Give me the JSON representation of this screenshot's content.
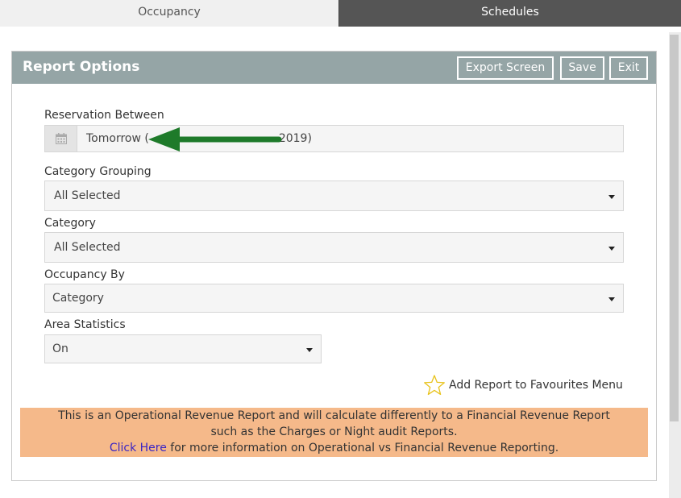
{
  "tabs": [
    {
      "label": "Occupancy"
    },
    {
      "label": "Schedules"
    }
  ],
  "panel": {
    "title": "Report Options",
    "buttons": {
      "export": "Export Screen",
      "save": "Save",
      "exit": "Exit"
    }
  },
  "fields": {
    "reservation_between": {
      "label": "Reservation Between",
      "value_start": "Tomorrow (",
      "value_end": "2019)"
    },
    "category_grouping": {
      "label": "Category Grouping",
      "value": "All Selected"
    },
    "category": {
      "label": "Category",
      "value": "All Selected"
    },
    "occupancy_by": {
      "label": "Occupancy By",
      "value": "Category"
    },
    "area_statistics": {
      "label": "Area Statistics",
      "value": "On"
    }
  },
  "favourites": {
    "label": "Add Report to Favourites Menu",
    "icon": "star-outline-icon"
  },
  "notice": {
    "line1": "This is an Operational Revenue Report and will calculate differently to a Financial Revenue Report",
    "line2": "such as the Charges or Night audit Reports.",
    "link": "Click Here",
    "line3": " for more information on Operational vs Financial Revenue Reporting."
  },
  "colors": {
    "header": "#95a5a6",
    "active_tab": "#555555",
    "notice": "#f5b98a",
    "arrow": "#1e7a2a",
    "star": "#e8c21a",
    "link": "#3b26c4"
  }
}
